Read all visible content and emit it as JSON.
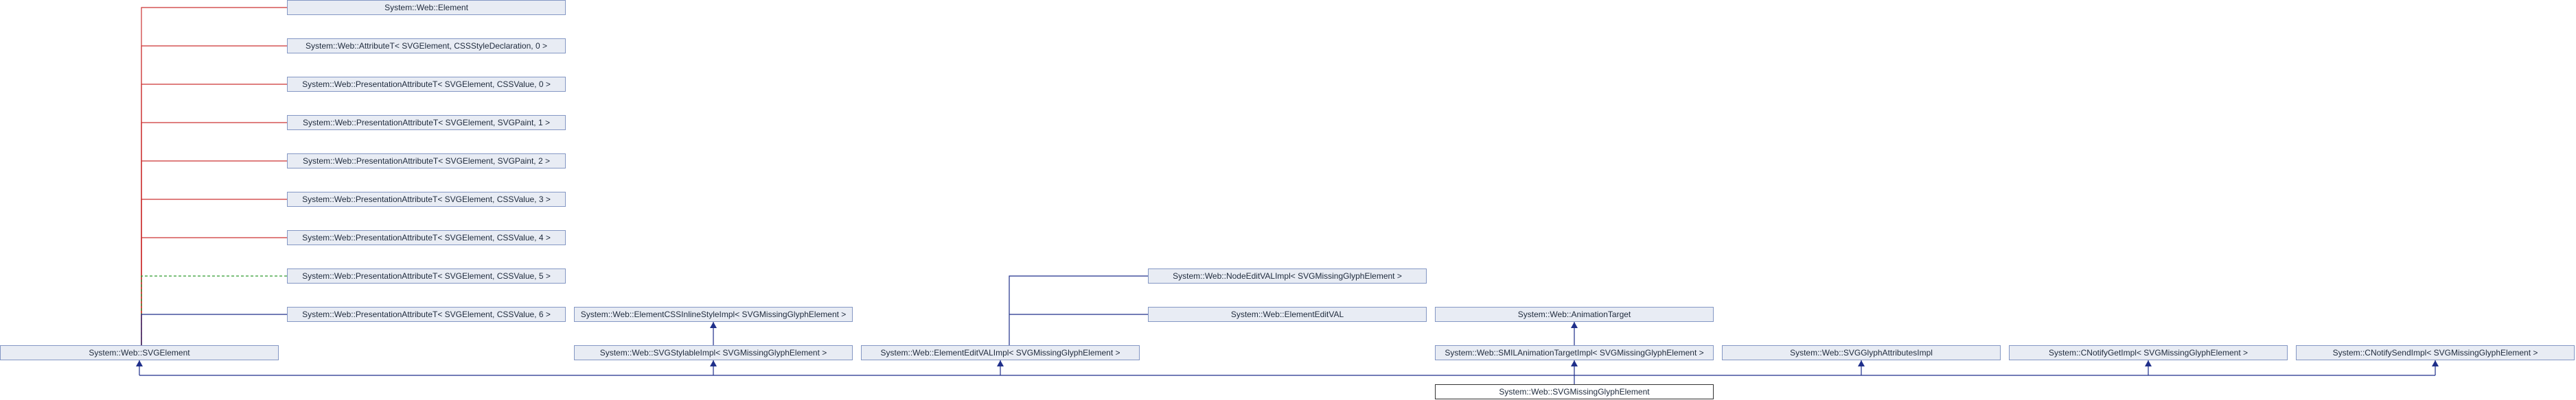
{
  "diagram": {
    "nodes": [
      {
        "id": "element",
        "label": "System::Web::Element"
      },
      {
        "id": "attr0",
        "label": "System::Web::AttributeT< SVGElement, CSSStyleDeclaration, 0 >"
      },
      {
        "id": "pres0",
        "label": "System::Web::PresentationAttributeT< SVGElement, CSSValue, 0 >"
      },
      {
        "id": "pres1",
        "label": "System::Web::PresentationAttributeT< SVGElement, SVGPaint, 1 >"
      },
      {
        "id": "pres2",
        "label": "System::Web::PresentationAttributeT< SVGElement, SVGPaint, 2 >"
      },
      {
        "id": "pres3",
        "label": "System::Web::PresentationAttributeT< SVGElement, CSSValue, 3 >"
      },
      {
        "id": "pres4",
        "label": "System::Web::PresentationAttributeT< SVGElement, CSSValue, 4 >"
      },
      {
        "id": "pres5",
        "label": "System::Web::PresentationAttributeT< SVGElement, CSSValue, 5 >"
      },
      {
        "id": "pres6",
        "label": "System::Web::PresentationAttributeT< SVGElement, CSSValue, 6 >"
      },
      {
        "id": "svgelement",
        "label": "System::Web::SVGElement"
      },
      {
        "id": "cssinline",
        "label": "System::Web::ElementCSSInlineStyleImpl< SVGMissingGlyphElement >"
      },
      {
        "id": "stylable",
        "label": "System::Web::SVGStylableImpl< SVGMissingGlyphElement >"
      },
      {
        "id": "nodeeditval",
        "label": "System::Web::NodeEditVALImpl< SVGMissingGlyphElement >"
      },
      {
        "id": "elementeditval",
        "label": "System::Web::ElementEditVAL"
      },
      {
        "id": "elementeditvalimpl",
        "label": "System::Web::ElementEditVALImpl< SVGMissingGlyphElement >"
      },
      {
        "id": "animtarget",
        "label": "System::Web::AnimationTarget"
      },
      {
        "id": "smilanim",
        "label": "System::Web::SMILAnimationTargetImpl< SVGMissingGlyphElement >"
      },
      {
        "id": "glyphattrs",
        "label": "System::Web::SVGGlyphAttributesImpl"
      },
      {
        "id": "notifyget",
        "label": "System::CNotifyGetImpl< SVGMissingGlyphElement >"
      },
      {
        "id": "notifysend",
        "label": "System::CNotifySendImpl< SVGMissingGlyphElement >"
      },
      {
        "id": "current",
        "label": "System::Web::SVGMissingGlyphElement"
      }
    ],
    "edges": [
      {
        "from": "element",
        "to": "svgelement",
        "kind": "uses"
      },
      {
        "from": "attr0",
        "to": "svgelement",
        "kind": "uses"
      },
      {
        "from": "pres0",
        "to": "svgelement",
        "kind": "uses"
      },
      {
        "from": "pres1",
        "to": "svgelement",
        "kind": "uses"
      },
      {
        "from": "pres2",
        "to": "svgelement",
        "kind": "uses"
      },
      {
        "from": "pres3",
        "to": "svgelement",
        "kind": "uses"
      },
      {
        "from": "pres4",
        "to": "svgelement",
        "kind": "uses"
      },
      {
        "from": "pres5",
        "to": "svgelement",
        "kind": "template"
      },
      {
        "from": "pres6",
        "to": "svgelement",
        "kind": "inherit"
      },
      {
        "from": "cssinline",
        "to": "stylable",
        "kind": "inherit"
      },
      {
        "from": "nodeeditval",
        "to": "elementeditvalimpl",
        "kind": "inherit"
      },
      {
        "from": "elementeditval",
        "to": "elementeditvalimpl",
        "kind": "inherit"
      },
      {
        "from": "animtarget",
        "to": "smilanim",
        "kind": "inherit"
      },
      {
        "from": "svgelement",
        "to": "current",
        "kind": "inherit"
      },
      {
        "from": "stylable",
        "to": "current",
        "kind": "inherit"
      },
      {
        "from": "elementeditvalimpl",
        "to": "current",
        "kind": "inherit"
      },
      {
        "from": "smilanim",
        "to": "current",
        "kind": "inherit"
      },
      {
        "from": "glyphattrs",
        "to": "current",
        "kind": "inherit"
      },
      {
        "from": "notifyget",
        "to": "current",
        "kind": "inherit"
      },
      {
        "from": "notifysend",
        "to": "current",
        "kind": "inherit"
      }
    ],
    "colors": {
      "inherit": "#1f2f8a",
      "uses": "#cc3333",
      "template": "#2e9a2e",
      "node_fill": "#e8ecf4",
      "node_border": "#8497c4",
      "current_border": "#333333"
    }
  }
}
